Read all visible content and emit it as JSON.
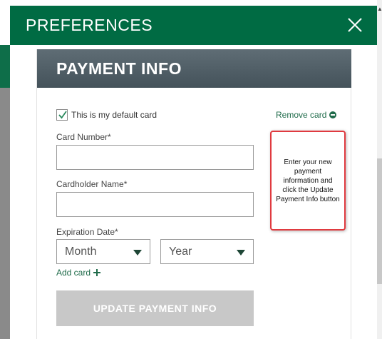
{
  "modal": {
    "title": "PREFERENCES",
    "close_icon": "close-icon"
  },
  "payment": {
    "title": "PAYMENT INFO",
    "default_card_label": "This is my default card",
    "default_card_checked": true,
    "remove_card_label": "Remove card",
    "card_number_label": "Card Number*",
    "card_number_value": "",
    "cardholder_label": "Cardholder Name*",
    "cardholder_value": "",
    "expiration_label": "Expiration Date*",
    "month_selected": "Month",
    "year_selected": "Year",
    "add_card_label": "Add card",
    "update_button_label": "UPDATE PAYMENT INFO"
  },
  "callout": {
    "text": "Enter your new payment information and click the Update Payment Info button"
  },
  "colors": {
    "header_green": "#006b43",
    "panel_header": "#4f5d65",
    "link_green": "#1f6b4a",
    "callout_border": "#e03a3f",
    "button_disabled": "#c8c8c8"
  }
}
